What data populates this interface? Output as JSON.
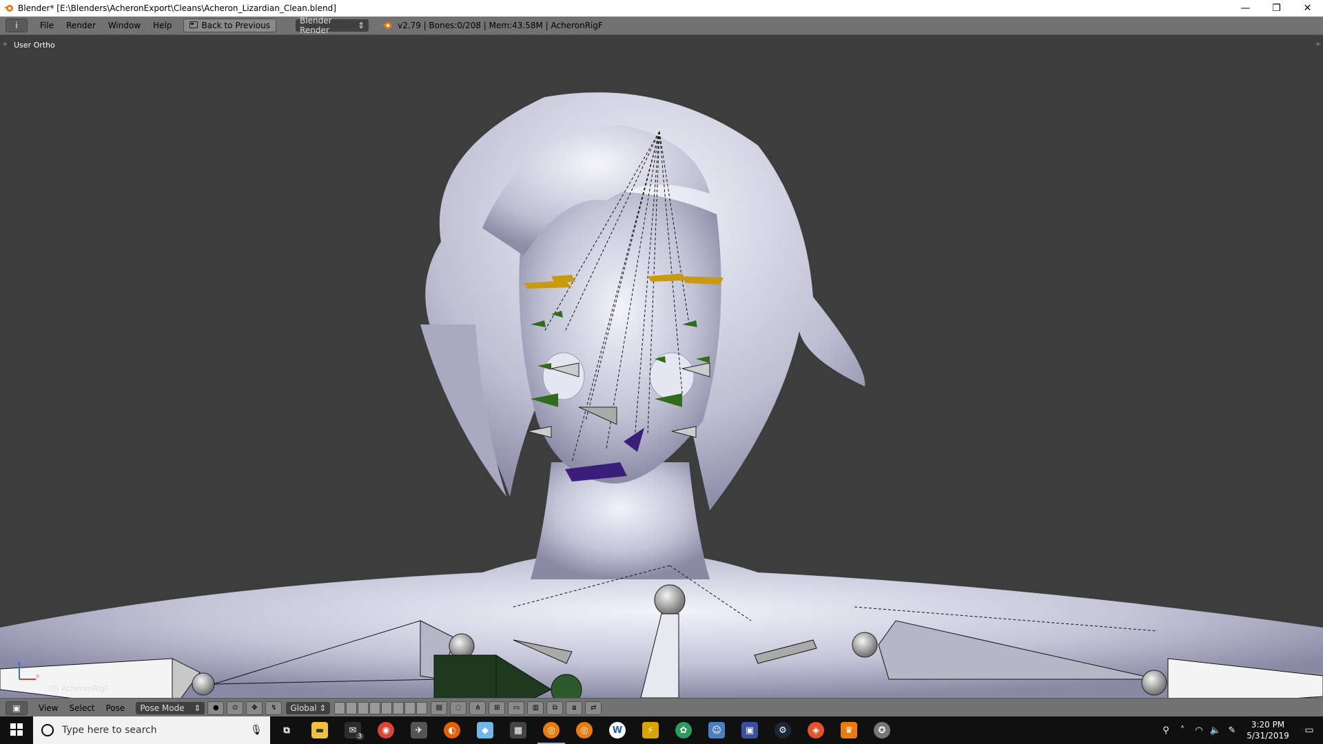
{
  "window": {
    "title": "Blender* [E:\\Blenders\\AcheronExport\\Cleans\\Acheron_Lizardian_Clean.blend]",
    "minimize": "—",
    "maximize": "❐",
    "close": "✕"
  },
  "info_header": {
    "editor_icon": "i",
    "menus": [
      "File",
      "Render",
      "Window",
      "Help"
    ],
    "back_button": "Back to Previous",
    "render_engine": "Blender Render",
    "stats": "v2.79 | Bones:0/208 | Mem:43.58M | AcheronRigF"
  },
  "viewport": {
    "view_name": "User Ortho",
    "active_object": "(0) AcheronRigF",
    "axis_x": "x",
    "axis_z": "z"
  },
  "view_header": {
    "menus": [
      "View",
      "Select",
      "Pose"
    ],
    "mode": "Pose Mode",
    "orientation": "Global"
  },
  "taskbar": {
    "search_placeholder": "Type here to search",
    "mail_badge": "3",
    "time": "3:20 PM",
    "date": "5/31/2019",
    "apps": [
      {
        "name": "task-view-icon",
        "color": "#101010",
        "glyph": "⧉"
      },
      {
        "name": "file-explorer-icon",
        "color": "#f0c040",
        "glyph": "▬"
      },
      {
        "name": "mail-icon",
        "color": "#2c2c2c",
        "glyph": "✉"
      },
      {
        "name": "chrome-icon",
        "color": "#db4437",
        "glyph": "◉"
      },
      {
        "name": "app-icon-generic",
        "color": "#555555",
        "glyph": "✈"
      },
      {
        "name": "firefox-icon",
        "color": "#e66000",
        "glyph": "◐"
      },
      {
        "name": "paint-icon",
        "color": "#6fb7e6",
        "glyph": "◆"
      },
      {
        "name": "calculator-icon",
        "color": "#444444",
        "glyph": "▦"
      },
      {
        "name": "blender-icon",
        "color": "#e87d0d",
        "glyph": "◎"
      },
      {
        "name": "blender-alt-icon",
        "color": "#e87d0d",
        "glyph": "◎"
      },
      {
        "name": "word-icon",
        "color": "#ffffff",
        "glyph": "W"
      },
      {
        "name": "lightning-app-icon",
        "color": "#d9a400",
        "glyph": "⚡"
      },
      {
        "name": "green-app-icon",
        "color": "#2e9b5f",
        "glyph": "✿"
      },
      {
        "name": "discord-like-icon",
        "color": "#4a7fbf",
        "glyph": "☺"
      },
      {
        "name": "calendar-app-icon",
        "color": "#3a4fa0",
        "glyph": "▣"
      },
      {
        "name": "steam-icon",
        "color": "#1b2838",
        "glyph": "⚙"
      },
      {
        "name": "maps-app-icon",
        "color": "#e5532d",
        "glyph": "◈"
      },
      {
        "name": "crown-app-icon",
        "color": "#e87d0d",
        "glyph": "♛"
      },
      {
        "name": "settings-app-icon",
        "color": "#777777",
        "glyph": "✪"
      }
    ]
  },
  "colors": {
    "viewport_bg": "#3d3d3d",
    "header_bg": "#727272",
    "mesh": "#c8c8dc",
    "bone_yellow": "#c89a10",
    "bone_green": "#2f6d1a",
    "bone_purple": "#3a1f7a",
    "bone_selected_dark": "#1e3a1e"
  }
}
